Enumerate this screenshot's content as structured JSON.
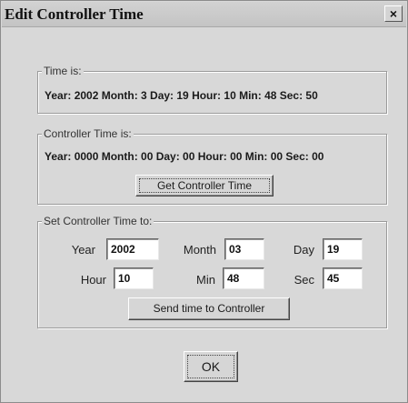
{
  "window": {
    "title": "Edit Controller Time",
    "close_label": "×"
  },
  "time_is": {
    "legend": "Time is:",
    "text": "Year: 2002 Month:  3 Day: 19 Hour: 10 Min: 48 Sec: 50"
  },
  "controller_time": {
    "legend": "Controller Time is:",
    "text": "Year: 0000 Month: 00 Day: 00 Hour: 00 Min: 00 Sec: 00",
    "get_button": "Get Controller Time"
  },
  "set_time": {
    "legend": "Set Controller Time to:",
    "labels": {
      "year": "Year",
      "month": "Month",
      "day": "Day",
      "hour": "Hour",
      "min": "Min",
      "sec": "Sec"
    },
    "values": {
      "year": "2002",
      "month": "03",
      "day": "19",
      "hour": "10",
      "min": "48",
      "sec": "45"
    },
    "send_button": "Send time to Controller"
  },
  "ok_button": "OK"
}
